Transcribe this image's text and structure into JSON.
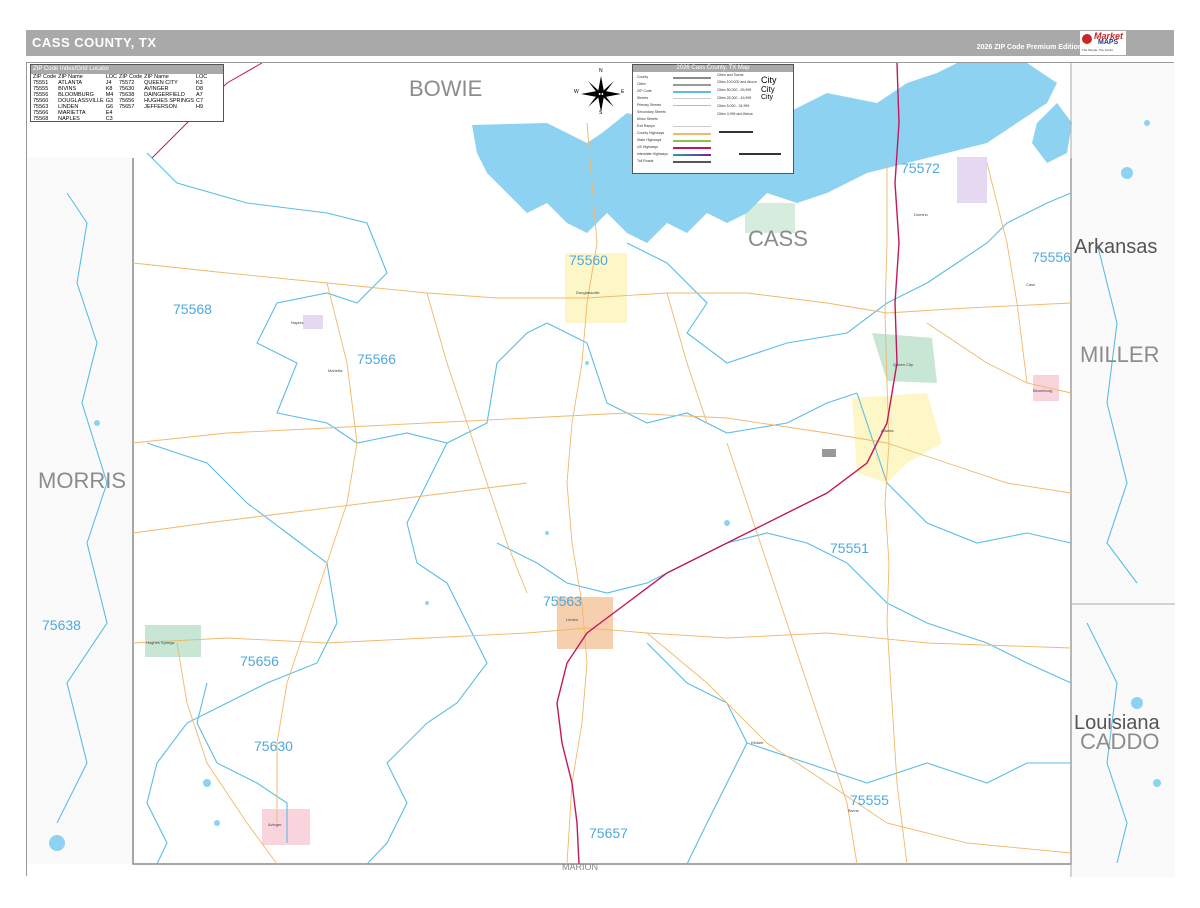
{
  "header": {
    "title": "CASS COUNTY, TX",
    "edition": "2026 ZIP Code Premium Edition",
    "logo_line1": "Market",
    "logo_line2": "MAPS",
    "logo_tag": "The Simple, The Smart",
    "bg_color": "#a9a9a9"
  },
  "zip_index": {
    "title": "ZIP Code Index/Grid Locator",
    "headers": [
      "ZIP Code",
      "ZIP Name",
      "LOC",
      "ZIP Code",
      "ZIP Name",
      "LOC"
    ],
    "rows": [
      [
        "75551",
        "ATLANTA",
        "J4",
        "75572",
        "QUEEN CITY",
        "K3"
      ],
      [
        "75555",
        "BIVINS",
        "K8",
        "75630",
        "AVINGER",
        "D8"
      ],
      [
        "75556",
        "BLOOMBURG",
        "M4",
        "75638",
        "DAINGERFIELD",
        "A7"
      ],
      [
        "75560",
        "DOUGLASSVILLE",
        "G3",
        "75656",
        "HUGHES SPRINGS",
        "C7"
      ],
      [
        "75563",
        "LINDEN",
        "G6",
        "75657",
        "JEFFERSON",
        "H9"
      ],
      [
        "75566",
        "MARIETTA",
        "E4",
        "",
        "",
        ""
      ],
      [
        "75568",
        "NAPLES",
        "C3",
        "",
        "",
        ""
      ]
    ]
  },
  "legend": {
    "title": "2026 Cass County, TX Map",
    "items": [
      "County",
      "Cities",
      "ZIP Code",
      "Streets",
      "Primary Streets",
      "Secondary Streets",
      "Minor Streets",
      "Exit Ramps",
      "County Highways",
      "State Highways",
      "US Highways",
      "Interstate Highways",
      "Toll Roads"
    ],
    "right_header": "Cities and Towns",
    "city_sizes": [
      "Cities 100,000 and Above",
      "Cities 50,000 - 99,999",
      "Cities 25,000 - 49,999",
      "Cities 5,000 - 24,999",
      "Cities 4,999 and Below"
    ],
    "city_samples": [
      "City",
      "City",
      "City"
    ]
  },
  "compass": {
    "n": "N",
    "e": "E",
    "s": "S",
    "w": "W"
  },
  "labels": {
    "counties": [
      "BOWIE",
      "CASS",
      "MILLER",
      "MORRIS",
      "CADDO",
      "MARION"
    ],
    "states": [
      "Arkansas",
      "Louisiana"
    ],
    "zips": [
      "75572",
      "75556",
      "75560",
      "75568",
      "75566",
      "75551",
      "75563",
      "75638",
      "75656",
      "75630",
      "75555",
      "75657"
    ],
    "towns": [
      "Cass",
      "Atlanta",
      "Linden",
      "Hughes Springs",
      "Avinger",
      "Queen City",
      "Douglassville",
      "Bivins",
      "Marietta",
      "Naples",
      "Bloomburg",
      "Kildare",
      "Domino"
    ]
  },
  "colors": {
    "water": "#8ed2f2",
    "zip_boundary": "#5bbde6",
    "roads": "#f0b86a",
    "us_highway": "#c2185b",
    "county_border": "#8a8a8a",
    "zip_label": "#4fa8dd",
    "zip_fill_yellow": "#fdf4b8",
    "zip_fill_green": "#b9e0c9",
    "zip_fill_pink": "#f7c9d4",
    "zip_fill_orange": "#f4c49a",
    "zip_fill_purple": "#ddd0ec"
  }
}
